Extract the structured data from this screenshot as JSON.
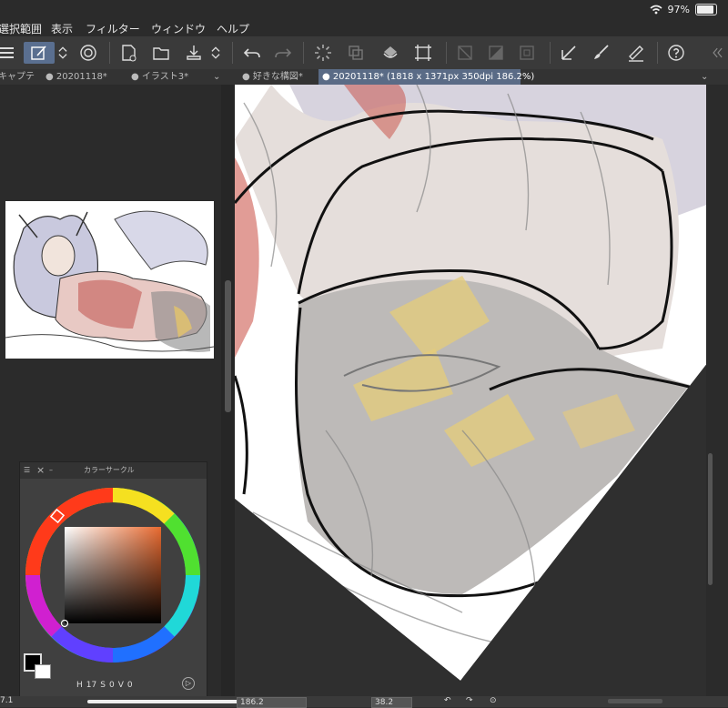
{
  "menu": [
    "選択範囲",
    "表示",
    "フィルター",
    "ウィンドウ",
    "ヘルプ"
  ],
  "status": {
    "battery": "97%"
  },
  "left_tabs": [
    "キャプテ",
    "20201118*",
    "イラスト3*"
  ],
  "canvas_tabs": [
    {
      "label": "好きな構図*",
      "active": false
    },
    {
      "label": "20201118* (1818 x 1371px 350dpi 186.2%)",
      "active": true
    }
  ],
  "color_panel": {
    "title": "カラーサークル",
    "h_label": "H",
    "h_value": "17",
    "s_label": "S",
    "s_value": "0",
    "v_label": "V",
    "v_value": "0"
  },
  "bottom": {
    "zoom": "186.2",
    "angle": "38.2",
    "left_value": "7.1"
  },
  "colors": {
    "accent": "#5a6b86",
    "toolbar": "#3a3a3a",
    "panel": "#2b2b2b"
  }
}
